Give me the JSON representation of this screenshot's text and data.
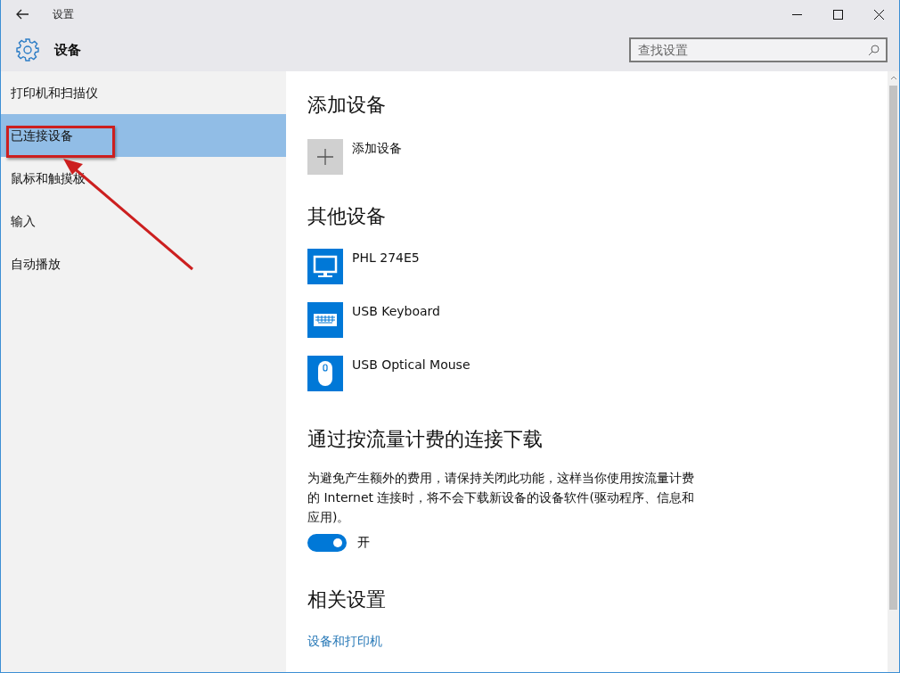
{
  "window": {
    "title": "设置"
  },
  "header": {
    "title": "设备",
    "search": {
      "placeholder": "查找设置"
    }
  },
  "sidebar": {
    "items": [
      {
        "label": "打印机和扫描仪",
        "selected": false
      },
      {
        "label": "已连接设备",
        "selected": true
      },
      {
        "label": "鼠标和触摸板",
        "selected": false
      },
      {
        "label": "输入",
        "selected": false
      },
      {
        "label": "自动播放",
        "selected": false
      }
    ]
  },
  "add_section": {
    "title": "添加设备",
    "button": "添加设备"
  },
  "other_devices": {
    "title": "其他设备",
    "devices": [
      {
        "name": "PHL 274E5",
        "kind": "monitor"
      },
      {
        "name": "USB Keyboard",
        "kind": "keyboard"
      },
      {
        "name": "USB Optical Mouse",
        "kind": "mouse"
      }
    ]
  },
  "metered": {
    "title": "通过按流量计费的连接下载",
    "description": "为避免产生额外的费用，请保持关闭此功能，这样当你使用按流量计费的 Internet 连接时，将不会下载新设备的设备软件(驱动程序、信息和应用)。",
    "toggle": {
      "on": true,
      "label": "开"
    }
  },
  "related": {
    "title": "相关设置",
    "links": [
      "设备和打印机"
    ]
  }
}
